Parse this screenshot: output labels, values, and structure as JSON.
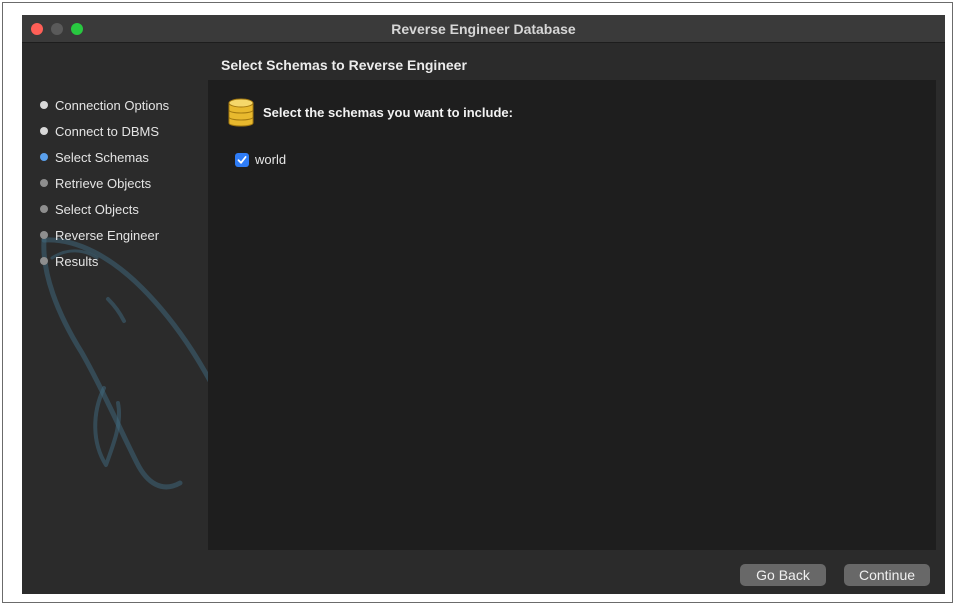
{
  "window": {
    "title": "Reverse Engineer Database",
    "traffic_lights": {
      "close_color": "#ff5f57",
      "minimize_color": "#5a5a5a",
      "maximize_color": "#28c840"
    }
  },
  "sidebar": {
    "steps": [
      {
        "label": "Connection Options",
        "state": "done"
      },
      {
        "label": "Connect to DBMS",
        "state": "done"
      },
      {
        "label": "Select Schemas",
        "state": "current"
      },
      {
        "label": "Retrieve Objects",
        "state": "pending"
      },
      {
        "label": "Select Objects",
        "state": "pending"
      },
      {
        "label": "Reverse Engineer",
        "state": "pending"
      },
      {
        "label": "Results",
        "state": "pending"
      }
    ],
    "current_step_color": "#5aa0ec",
    "watermark_icon": "dolphin-logo-icon"
  },
  "main": {
    "heading": "Select Schemas to Reverse Engineer",
    "prompt": "Select the schemas you want to include:",
    "prompt_icon": "database-icon",
    "schemas": [
      {
        "name": "world",
        "checked": true
      }
    ],
    "checkbox_color": "#2e7cf6"
  },
  "footer": {
    "back_label": "Go Back",
    "continue_label": "Continue"
  }
}
